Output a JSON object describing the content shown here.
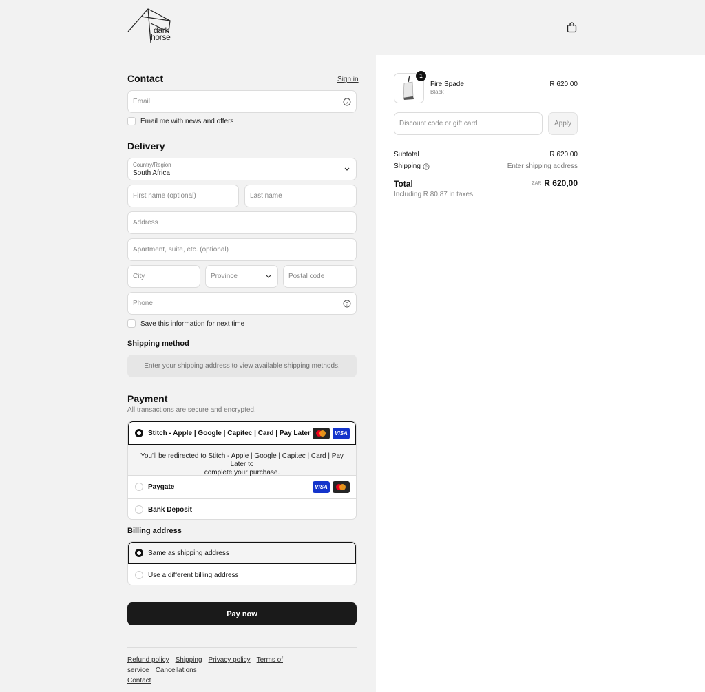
{
  "header": {
    "brand_line1": "dark",
    "brand_line2": "horse"
  },
  "contact": {
    "title": "Contact",
    "sign_in": "Sign in",
    "email_placeholder": "Email",
    "news_label": "Email me with news and offers"
  },
  "delivery": {
    "title": "Delivery",
    "country_label": "Country/Region",
    "country_value": "South Africa",
    "first_name_placeholder": "First name (optional)",
    "last_name_placeholder": "Last name",
    "address_placeholder": "Address",
    "apartment_placeholder": "Apartment, suite, etc. (optional)",
    "city_placeholder": "City",
    "province_placeholder": "Province",
    "postal_placeholder": "Postal code",
    "phone_placeholder": "Phone",
    "save_label": "Save this information for next time"
  },
  "shipping_method": {
    "title": "Shipping method",
    "message": "Enter your shipping address to view available shipping methods."
  },
  "payment": {
    "title": "Payment",
    "subtitle": "All transactions are secure and encrypted.",
    "options": [
      {
        "label": "Stitch - Apple | Google | Capitec | Card | Pay Later",
        "selected": true
      },
      {
        "label": "Paygate",
        "selected": false
      },
      {
        "label": "Bank Deposit",
        "selected": false
      }
    ],
    "redirect_line1": "You'll be redirected to Stitch - Apple | Google | Capitec | Card | Pay Later to",
    "redirect_line2": "complete your purchase.",
    "visa_label": "VISA"
  },
  "billing": {
    "title": "Billing address",
    "options": [
      {
        "label": "Same as shipping address",
        "selected": true
      },
      {
        "label": "Use a different billing address",
        "selected": false
      }
    ]
  },
  "pay_now": "Pay now",
  "footer": {
    "links": [
      "Refund policy",
      "Shipping",
      "Privacy policy",
      "Terms of service",
      "Cancellations",
      "Contact"
    ]
  },
  "summary": {
    "item": {
      "name": "Fire Spade",
      "variant": "Black",
      "price": "R 620,00",
      "quantity": "1"
    },
    "discount_placeholder": "Discount code or gift card",
    "apply": "Apply",
    "subtotal_label": "Subtotal",
    "subtotal_value": "R 620,00",
    "shipping_label": "Shipping",
    "shipping_value": "Enter shipping address",
    "total_label": "Total",
    "currency": "ZAR",
    "total_value": "R 620,00",
    "taxes_note": "Including R 80,87 in taxes"
  },
  "colors": {
    "primary_button": "#1a1a1a",
    "visa": "#1434cb",
    "mastercard_red": "#eb001b",
    "mastercard_orange": "#f79e1b"
  },
  "icons": [
    "shopping-bag-icon",
    "help-circle-icon",
    "chevron-down-icon",
    "visa-icon",
    "mastercard-icon"
  ]
}
